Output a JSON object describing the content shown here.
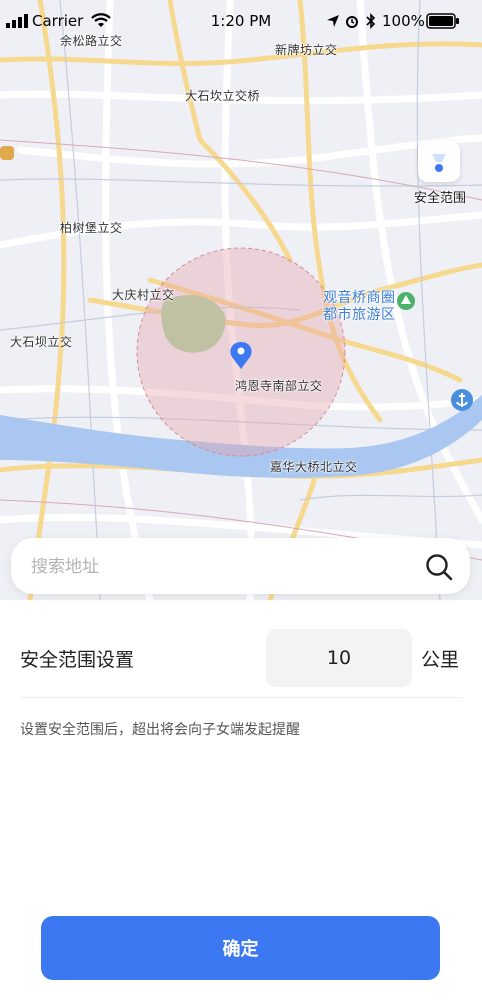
{
  "status_bar": {
    "carrier": "Carrier",
    "time": "1:20 PM",
    "battery": "100%"
  },
  "map": {
    "labels": [
      "余松路立交",
      "新牌坊立交",
      "大石坎立交桥",
      "柏树堡立交",
      "大庆村立交",
      "大石坝立交",
      "观音桥商圈",
      "都市旅游区",
      "鸿恩寺南部立交",
      "嘉华大桥北立交"
    ],
    "circle_color": "#e8a0a8",
    "river_color": "#a9c7f0",
    "park_color": "#a8d6a0",
    "pin_color": "#3b78f2"
  },
  "range_button": {
    "label": "安全范围",
    "icon": "funnel-pin-icon"
  },
  "search": {
    "placeholder": "搜索地址",
    "icon": "search-icon"
  },
  "settings": {
    "label": "安全范围设置",
    "value": "10",
    "unit": "公里",
    "hint": "设置安全范围后，超出将会向子女端发起提醒"
  },
  "confirm_button": {
    "label": "确定",
    "color": "#3b78f2"
  }
}
